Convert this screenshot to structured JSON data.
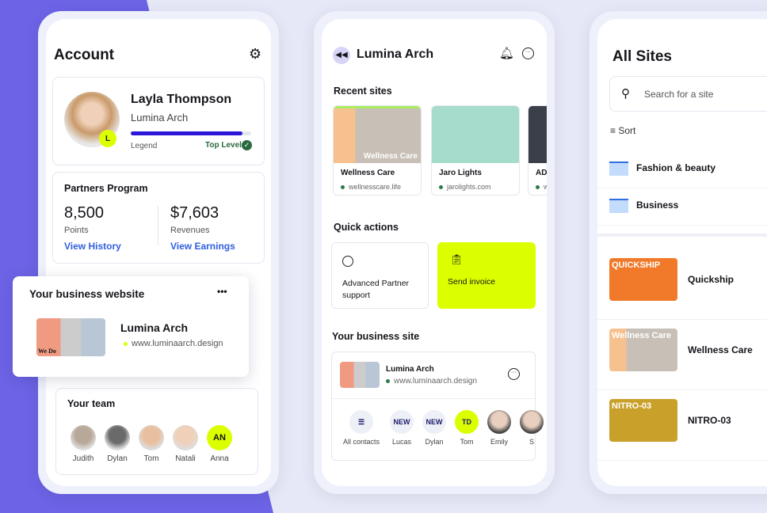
{
  "account": {
    "title": "Account",
    "name": "Layla Thompson",
    "company": "Lumina Arch",
    "avatar_badge": "L",
    "level_progress": 0.93,
    "level_label": "Legend",
    "level_status": "Top Level",
    "partners": {
      "title": "Partners Program",
      "points": "8,500",
      "points_label": "Points",
      "points_link": "View History",
      "revenue": "$7,603",
      "revenue_label": "Revenues",
      "revenue_link": "View Earnings"
    },
    "business": {
      "title": "Your business website",
      "more": "•••",
      "site_name": "Lumina Arch",
      "site_url": "www.luminaarch.design",
      "thumb_text": "We Do"
    },
    "team": {
      "title": "Your team",
      "members": [
        {
          "name": "Judith"
        },
        {
          "name": "Dylan"
        },
        {
          "name": "Tom"
        },
        {
          "name": "Natali"
        },
        {
          "name": "Anna",
          "initials": "AN"
        }
      ]
    }
  },
  "dashboard": {
    "title": "Lumina Arch",
    "recent_title": "Recent sites",
    "recent": [
      {
        "name": "Wellness Care",
        "url": "wellnesscare.life",
        "thumb_text": "Wellness Care"
      },
      {
        "name": "Jaro Lights",
        "url": "jarolights.com"
      },
      {
        "name": "AD",
        "url": "w"
      }
    ],
    "quick_title": "Quick actions",
    "quick": [
      {
        "label": "Advanced Partner support"
      },
      {
        "label": "Send invoice"
      }
    ],
    "site_title": "Your business site",
    "site_name": "Lumina Arch",
    "site_url": "www.luminaarch.design",
    "contacts": [
      {
        "label": "All contacts"
      },
      {
        "label": "Lucas",
        "badge": "NEW"
      },
      {
        "label": "Dylan",
        "badge": "NEW"
      },
      {
        "label": "Tom",
        "badge": "TD"
      },
      {
        "label": "Emily"
      },
      {
        "label": "S"
      }
    ]
  },
  "all_sites": {
    "title": "All Sites",
    "search_placeholder": "Search for a site",
    "sort": "Sort",
    "folders": [
      "Fashion & beauty",
      "Business"
    ],
    "sites": [
      {
        "name": "Quickship",
        "thumb_text": "QUICKSHIP"
      },
      {
        "name": "Wellness Care",
        "thumb_text": "Wellness Care"
      },
      {
        "name": "NITRO-03",
        "thumb_text": "NITRO-03"
      }
    ]
  },
  "colors": {
    "accent": "#dcff00",
    "purple": "#6c63e6",
    "progress": "#2b16d9",
    "link": "#2f5fe0"
  }
}
